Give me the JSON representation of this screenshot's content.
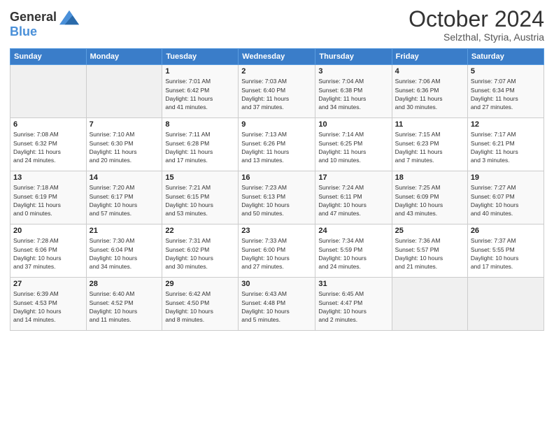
{
  "logo": {
    "line1": "General",
    "line2": "Blue"
  },
  "title": "October 2024",
  "subtitle": "Selzthal, Styria, Austria",
  "weekdays": [
    "Sunday",
    "Monday",
    "Tuesday",
    "Wednesday",
    "Thursday",
    "Friday",
    "Saturday"
  ],
  "weeks": [
    [
      {
        "num": "",
        "detail": ""
      },
      {
        "num": "",
        "detail": ""
      },
      {
        "num": "1",
        "detail": "Sunrise: 7:01 AM\nSunset: 6:42 PM\nDaylight: 11 hours\nand 41 minutes."
      },
      {
        "num": "2",
        "detail": "Sunrise: 7:03 AM\nSunset: 6:40 PM\nDaylight: 11 hours\nand 37 minutes."
      },
      {
        "num": "3",
        "detail": "Sunrise: 7:04 AM\nSunset: 6:38 PM\nDaylight: 11 hours\nand 34 minutes."
      },
      {
        "num": "4",
        "detail": "Sunrise: 7:06 AM\nSunset: 6:36 PM\nDaylight: 11 hours\nand 30 minutes."
      },
      {
        "num": "5",
        "detail": "Sunrise: 7:07 AM\nSunset: 6:34 PM\nDaylight: 11 hours\nand 27 minutes."
      }
    ],
    [
      {
        "num": "6",
        "detail": "Sunrise: 7:08 AM\nSunset: 6:32 PM\nDaylight: 11 hours\nand 24 minutes."
      },
      {
        "num": "7",
        "detail": "Sunrise: 7:10 AM\nSunset: 6:30 PM\nDaylight: 11 hours\nand 20 minutes."
      },
      {
        "num": "8",
        "detail": "Sunrise: 7:11 AM\nSunset: 6:28 PM\nDaylight: 11 hours\nand 17 minutes."
      },
      {
        "num": "9",
        "detail": "Sunrise: 7:13 AM\nSunset: 6:26 PM\nDaylight: 11 hours\nand 13 minutes."
      },
      {
        "num": "10",
        "detail": "Sunrise: 7:14 AM\nSunset: 6:25 PM\nDaylight: 11 hours\nand 10 minutes."
      },
      {
        "num": "11",
        "detail": "Sunrise: 7:15 AM\nSunset: 6:23 PM\nDaylight: 11 hours\nand 7 minutes."
      },
      {
        "num": "12",
        "detail": "Sunrise: 7:17 AM\nSunset: 6:21 PM\nDaylight: 11 hours\nand 3 minutes."
      }
    ],
    [
      {
        "num": "13",
        "detail": "Sunrise: 7:18 AM\nSunset: 6:19 PM\nDaylight: 11 hours\nand 0 minutes."
      },
      {
        "num": "14",
        "detail": "Sunrise: 7:20 AM\nSunset: 6:17 PM\nDaylight: 10 hours\nand 57 minutes."
      },
      {
        "num": "15",
        "detail": "Sunrise: 7:21 AM\nSunset: 6:15 PM\nDaylight: 10 hours\nand 53 minutes."
      },
      {
        "num": "16",
        "detail": "Sunrise: 7:23 AM\nSunset: 6:13 PM\nDaylight: 10 hours\nand 50 minutes."
      },
      {
        "num": "17",
        "detail": "Sunrise: 7:24 AM\nSunset: 6:11 PM\nDaylight: 10 hours\nand 47 minutes."
      },
      {
        "num": "18",
        "detail": "Sunrise: 7:25 AM\nSunset: 6:09 PM\nDaylight: 10 hours\nand 43 minutes."
      },
      {
        "num": "19",
        "detail": "Sunrise: 7:27 AM\nSunset: 6:07 PM\nDaylight: 10 hours\nand 40 minutes."
      }
    ],
    [
      {
        "num": "20",
        "detail": "Sunrise: 7:28 AM\nSunset: 6:06 PM\nDaylight: 10 hours\nand 37 minutes."
      },
      {
        "num": "21",
        "detail": "Sunrise: 7:30 AM\nSunset: 6:04 PM\nDaylight: 10 hours\nand 34 minutes."
      },
      {
        "num": "22",
        "detail": "Sunrise: 7:31 AM\nSunset: 6:02 PM\nDaylight: 10 hours\nand 30 minutes."
      },
      {
        "num": "23",
        "detail": "Sunrise: 7:33 AM\nSunset: 6:00 PM\nDaylight: 10 hours\nand 27 minutes."
      },
      {
        "num": "24",
        "detail": "Sunrise: 7:34 AM\nSunset: 5:59 PM\nDaylight: 10 hours\nand 24 minutes."
      },
      {
        "num": "25",
        "detail": "Sunrise: 7:36 AM\nSunset: 5:57 PM\nDaylight: 10 hours\nand 21 minutes."
      },
      {
        "num": "26",
        "detail": "Sunrise: 7:37 AM\nSunset: 5:55 PM\nDaylight: 10 hours\nand 17 minutes."
      }
    ],
    [
      {
        "num": "27",
        "detail": "Sunrise: 6:39 AM\nSunset: 4:53 PM\nDaylight: 10 hours\nand 14 minutes."
      },
      {
        "num": "28",
        "detail": "Sunrise: 6:40 AM\nSunset: 4:52 PM\nDaylight: 10 hours\nand 11 minutes."
      },
      {
        "num": "29",
        "detail": "Sunrise: 6:42 AM\nSunset: 4:50 PM\nDaylight: 10 hours\nand 8 minutes."
      },
      {
        "num": "30",
        "detail": "Sunrise: 6:43 AM\nSunset: 4:48 PM\nDaylight: 10 hours\nand 5 minutes."
      },
      {
        "num": "31",
        "detail": "Sunrise: 6:45 AM\nSunset: 4:47 PM\nDaylight: 10 hours\nand 2 minutes."
      },
      {
        "num": "",
        "detail": ""
      },
      {
        "num": "",
        "detail": ""
      }
    ]
  ]
}
